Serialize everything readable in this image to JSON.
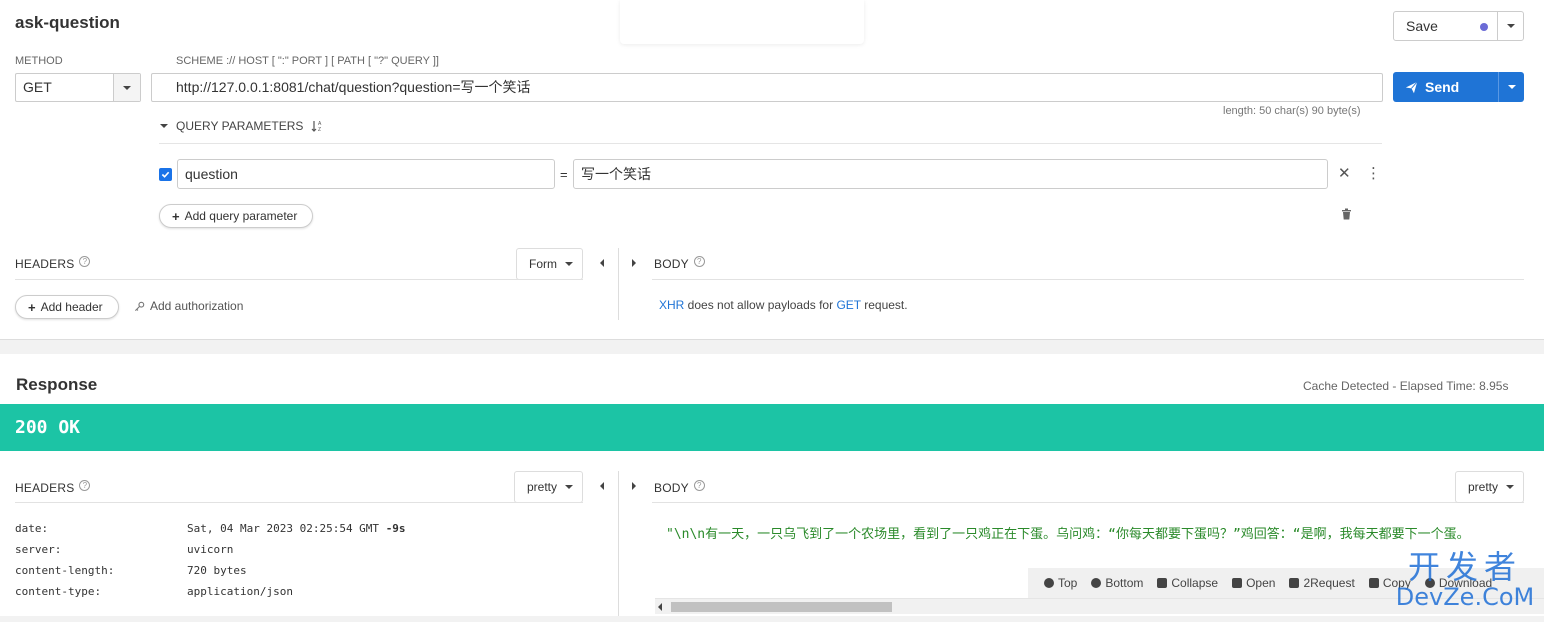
{
  "request": {
    "title": "ask-question",
    "save_label": "Save",
    "method_label": "METHOD",
    "method_value": "GET",
    "scheme_hint": "SCHEME :// HOST [ \":\" PORT ] [ PATH [ \"?\" QUERY ]]",
    "url": "http://127.0.0.1:8081/chat/question?question=写一个笑话",
    "send_label": "Send",
    "length_info": "length: 50 char(s) 90 byte(s)",
    "query_params_label": "QUERY PARAMETERS",
    "params": [
      {
        "checked": true,
        "name": "question",
        "value": "写一个笑话"
      }
    ],
    "equals": "=",
    "add_query_param_label": "Add query parameter",
    "headers_label": "HEADERS",
    "form_label": "Form",
    "add_header_label": "Add header",
    "add_auth_label": "Add authorization",
    "body_label": "BODY",
    "body_note": {
      "xhr": "XHR",
      "middle": " does not allow payloads for ",
      "method": "GET",
      "end": " request."
    }
  },
  "response": {
    "title": "Response",
    "cache_info": "Cache Detected - Elapsed Time: 8.95s",
    "status": "200 OK",
    "status_color": "#1cc4a5",
    "headers_label": "HEADERS",
    "pretty_label": "pretty",
    "body_label": "BODY",
    "headers": [
      {
        "key": "date:",
        "value": "Sat, 04 Mar 2023 02:25:54 GMT ",
        "extra": "-9s"
      },
      {
        "key": "server:",
        "value": "uvicorn",
        "extra": ""
      },
      {
        "key": "content-length:",
        "value": "720 bytes",
        "extra": ""
      },
      {
        "key": "content-type:",
        "value": "application/json",
        "extra": ""
      }
    ],
    "body_text": "\"\\n\\n有一天，一只乌飞到了一个农场里，看到了一只鸡正在下蛋。乌问鸡：“你每天都要下蛋吗？”鸡回答：“是啊，我每天都要下一个蛋。",
    "toolbar": {
      "top": "Top",
      "bottom": "Bottom",
      "collapse": "Collapse",
      "open": "Open",
      "request": "2Request",
      "copy": "Copy",
      "download": "Download"
    }
  },
  "watermark": {
    "cn": "开发者",
    "en": "DevZe.CoM"
  },
  "colors": {
    "accent": "#1f74d6",
    "status_ok": "#1cc4a5",
    "body_text": "#2a8a2a"
  }
}
